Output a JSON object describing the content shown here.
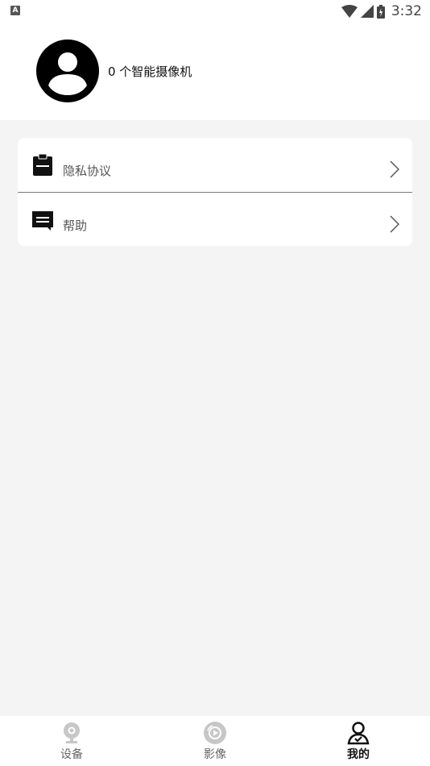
{
  "status_bar": {
    "notification_badge": "A",
    "time": "3:32",
    "icons": [
      "wifi-icon",
      "signal-icon",
      "battery-icon"
    ]
  },
  "profile": {
    "avatar_icon": "avatar-icon",
    "camera_count_text": "0 个智能摄像机"
  },
  "menu": {
    "items": [
      {
        "label": "隐私协议",
        "icon": "clipboard-icon"
      },
      {
        "label": "帮助",
        "icon": "chat-icon"
      }
    ]
  },
  "bottom_nav": {
    "tabs": [
      {
        "label": "设备",
        "icon": "camera-icon",
        "active": false
      },
      {
        "label": "影像",
        "icon": "record-icon",
        "active": false
      },
      {
        "label": "我的",
        "icon": "person-icon",
        "active": true
      }
    ]
  },
  "colors": {
    "background": "#f4f4f4",
    "card": "#ffffff",
    "active_text": "#111111",
    "inactive_icon": "#c7c7c7"
  }
}
